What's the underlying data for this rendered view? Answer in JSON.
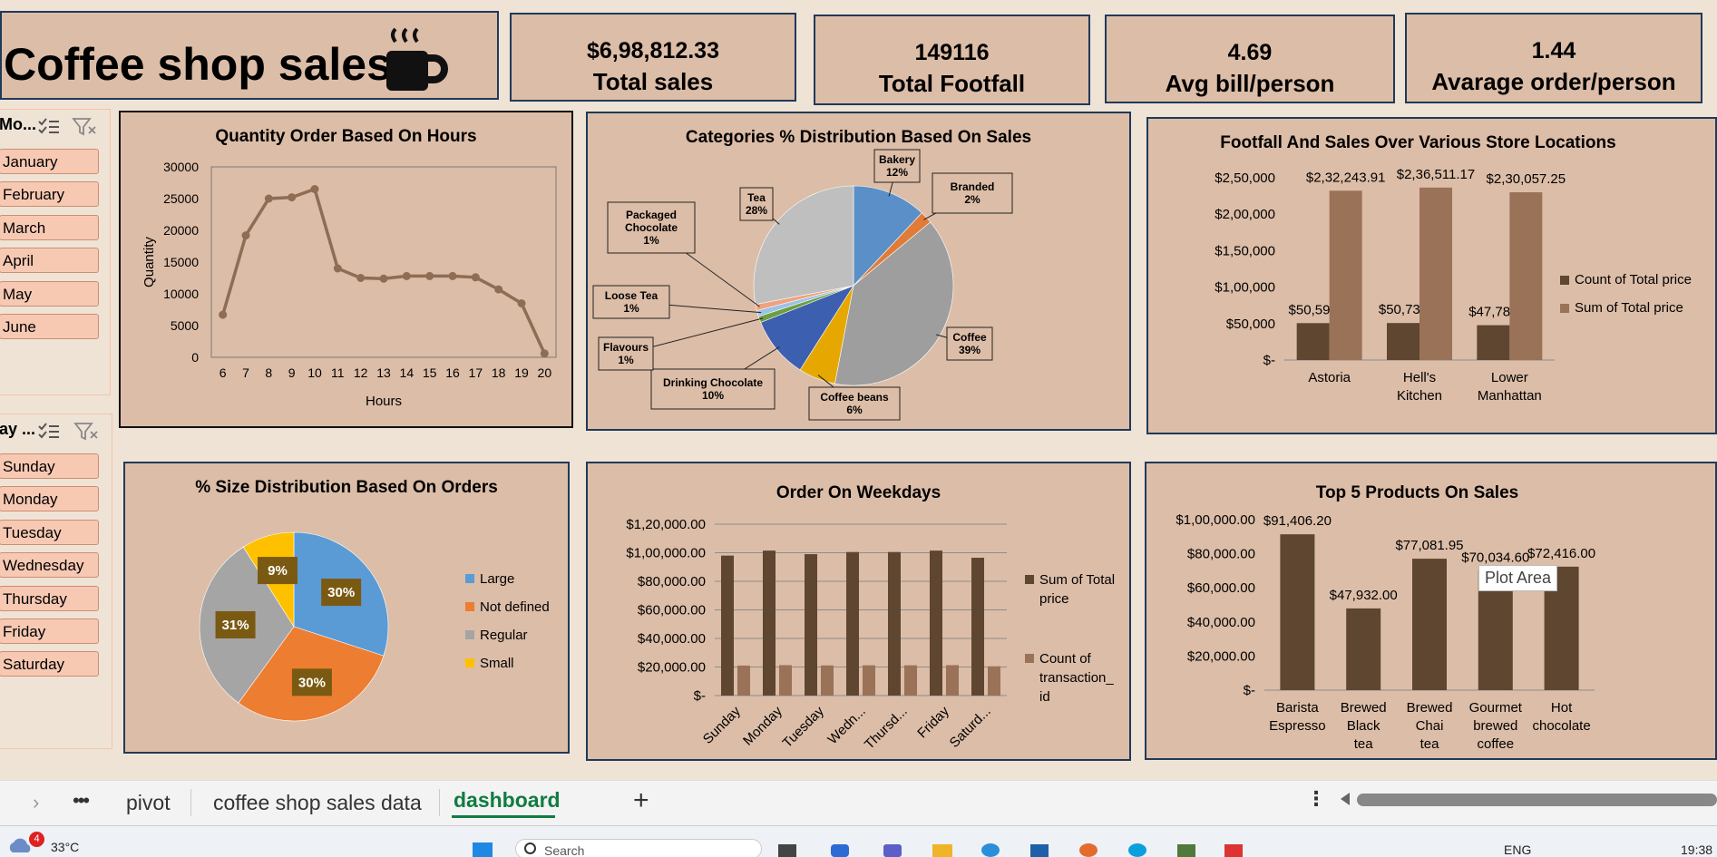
{
  "header": {
    "title": "Coffee shop sales"
  },
  "kpis": [
    {
      "value": "$6,98,812.33",
      "label": "Total sales"
    },
    {
      "value": "149116",
      "label": "Total Footfall"
    },
    {
      "value": "4.69",
      "label": "Avg bill/person"
    },
    {
      "value": "1.44",
      "label": "Avarage order/person"
    }
  ],
  "slicers": {
    "month": {
      "title": "Mo...",
      "items": [
        "January",
        "February",
        "March",
        "April",
        "May",
        "June"
      ]
    },
    "day": {
      "title": "ay ...",
      "items": [
        "Sunday",
        "Monday",
        "Tuesday",
        "Wednesday",
        "Thursday",
        "Friday",
        "Saturday"
      ]
    }
  },
  "colors": {
    "panel": "#dcbda7",
    "border": "#1f3a5a",
    "dark_bar": "#5e4631",
    "light_bar": "#9a7258",
    "line": "#8f6d54",
    "background": "#efe3d6"
  },
  "chart_data": [
    {
      "type": "line",
      "title": "Quantity Order Based On Hours",
      "xlabel": "Hours",
      "ylabel": "Quantity",
      "x": [
        6,
        7,
        8,
        9,
        10,
        11,
        12,
        13,
        14,
        15,
        16,
        17,
        18,
        19,
        20
      ],
      "values": [
        6700,
        19200,
        25000,
        25200,
        26500,
        14000,
        12500,
        12400,
        12800,
        12800,
        12800,
        12600,
        10700,
        8500,
        600
      ],
      "ylim": [
        0,
        30000
      ],
      "yticks": [
        "30000",
        "25000",
        "20000",
        "15000",
        "10000",
        "5000",
        "0"
      ]
    },
    {
      "type": "pie",
      "title": "Categories % Distribution Based On Sales",
      "slices": [
        {
          "name": "Bakery",
          "pct": "12%",
          "value": 12,
          "color": "#5b8fc7"
        },
        {
          "name": "Branded",
          "pct": "2%",
          "value": 2,
          "color": "#e07b39"
        },
        {
          "name": "Coffee",
          "pct": "39%",
          "value": 39,
          "color": "#9e9e9e"
        },
        {
          "name": "Coffee beans",
          "pct": "6%",
          "value": 6,
          "color": "#e6a800"
        },
        {
          "name": "Drinking Chocolate",
          "pct": "10%",
          "value": 10,
          "color": "#3d5fb0"
        },
        {
          "name": "Flavours",
          "pct": "1%",
          "value": 1,
          "color": "#6d9e3f"
        },
        {
          "name": "Loose Tea",
          "pct": "1%",
          "value": 1,
          "color": "#9cc3e6"
        },
        {
          "name": "Packaged Chocolate",
          "pct": "1%",
          "value": 1,
          "color": "#f0a27c"
        },
        {
          "name": "Tea",
          "pct": "28%",
          "value": 28,
          "color": "#bfbfbf"
        }
      ]
    },
    {
      "type": "bar",
      "title": "Footfall And Sales Over Various Store Locations",
      "categories": [
        "Astoria",
        "Hell's Kitchen",
        "Lower Manhattan"
      ],
      "series": [
        {
          "name": "Count of Total price",
          "values": [
            50599,
            50735,
            47782
          ],
          "labels": [
            "$50,599",
            "$50,735",
            "$47,782"
          ]
        },
        {
          "name": "Sum of Total price",
          "values": [
            232243.91,
            236511.17,
            230057.25
          ],
          "labels": [
            "$2,32,243.91",
            "$2,36,511.17",
            "$2,30,057.25"
          ]
        }
      ],
      "ylim": [
        0,
        250000
      ],
      "yticks": [
        "$2,50,000",
        "$2,00,000",
        "$1,50,000",
        "$1,00,000",
        "$50,000",
        "$-"
      ]
    },
    {
      "type": "pie",
      "title": "% Size Distribution Based On Orders",
      "slices": [
        {
          "name": "Large",
          "pct": "30%",
          "value": 30,
          "color": "#5b9bd5"
        },
        {
          "name": "Not defined",
          "pct": "30%",
          "value": 30,
          "color": "#ed7d31"
        },
        {
          "name": "Regular",
          "pct": "31%",
          "value": 31,
          "color": "#a5a5a5"
        },
        {
          "name": "Small",
          "pct": "9%",
          "value": 9,
          "color": "#ffc000"
        }
      ]
    },
    {
      "type": "bar",
      "title": "Order On Weekdays",
      "categories": [
        "Sunday",
        "Monday",
        "Tuesday",
        "Wedn...",
        "Thursd...",
        "Friday",
        "Saturd..."
      ],
      "series": [
        {
          "name": "Sum of Total price",
          "values": [
            98000,
            101500,
            99000,
            100500,
            100500,
            101500,
            96500
          ]
        },
        {
          "name": "Count of transaction_id",
          "values": [
            21000,
            21300,
            21100,
            21200,
            21200,
            21300,
            20500
          ]
        }
      ],
      "ylim": [
        0,
        120000
      ],
      "yticks": [
        "$1,20,000.00",
        "$1,00,000.00",
        "$80,000.00",
        "$60,000.00",
        "$40,000.00",
        "$20,000.00",
        "$-"
      ]
    },
    {
      "type": "bar",
      "title": "Top 5 Products On Sales",
      "categories": [
        "Barista Espresso",
        "Brewed Black tea",
        "Brewed Chai tea",
        "Gourmet brewed coffee",
        "Hot chocolate"
      ],
      "values": [
        91406.2,
        47932.0,
        77081.95,
        70034.6,
        72416.0
      ],
      "labels": [
        "$91,406.20",
        "$47,932.00",
        "$77,081.95",
        "$70,034.60",
        "$72,416.00"
      ],
      "ylim": [
        0,
        100000
      ],
      "yticks": [
        "$1,00,000.00",
        "$80,000.00",
        "$60,000.00",
        "$40,000.00",
        "$20,000.00",
        "$-"
      ],
      "tooltip": "Plot Area"
    }
  ],
  "sheet_tabs": [
    "pivot",
    "coffee shop sales data",
    "dashboard"
  ],
  "active_tab": "dashboard",
  "taskbar": {
    "weather": "33°C",
    "notification_count": "4",
    "search_text": "Search",
    "language": "ENG",
    "time": "19:38"
  }
}
